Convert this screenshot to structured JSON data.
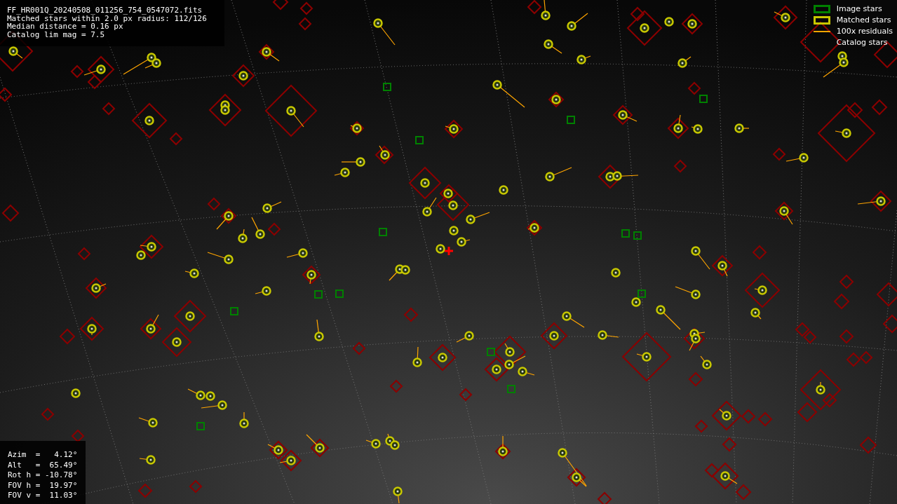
{
  "info_box": {
    "lines": [
      "FF_HR001Q_20240508_011256_754_0547072.fits",
      "Matched stars within 2.0 px radius: 112/126",
      "Median distance = 0.16 px",
      "Catalog lim mag = 7.5"
    ]
  },
  "legend": [
    {
      "kind": "box",
      "color": "#008000",
      "label": "Image stars"
    },
    {
      "kind": "box",
      "color": "#c8c800",
      "label": "Matched stars"
    },
    {
      "kind": "line",
      "color": "#ffa500",
      "label": "100x residuals"
    },
    {
      "kind": "none",
      "label": "Catalog stars"
    }
  ],
  "pointing": {
    "lines": [
      "Azim  =   4.12°",
      "Alt   =  65.49°",
      "Rot h = -10.78°",
      "FOV h =  19.97°",
      "FOV v =  11.03°"
    ]
  }
}
